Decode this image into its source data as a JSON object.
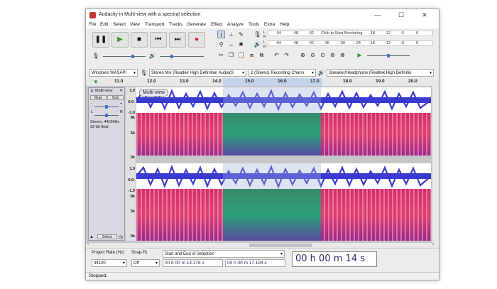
{
  "window": {
    "title": "Audacity in Multi-view with a spectral selection",
    "minimize": "—",
    "maximize": "☐",
    "close": "✕"
  },
  "menu": [
    "File",
    "Edit",
    "Select",
    "View",
    "Transport",
    "Tracks",
    "Generate",
    "Effect",
    "Analyze",
    "Tools",
    "Extra",
    "Help"
  ],
  "transport": {
    "pause": "❚❚",
    "play": "▶",
    "stop": "■",
    "skip_start": "⏮",
    "skip_end": "⏭",
    "record": "●"
  },
  "meters": {
    "record_ticks": [
      "-54",
      "-48",
      "-42",
      "",
      "-18",
      "-12",
      "-6",
      "0"
    ],
    "record_hint": "Click to Start Monitoring",
    "play_ticks": [
      "-54",
      "-48",
      "-42",
      "-36",
      "-30",
      "-24",
      "-18",
      "-12",
      "-6",
      "0"
    ]
  },
  "devices": {
    "host": "Windows WASAPI",
    "recording_device": "Stereo Mix (Realtek High Definition Audio(S",
    "channels": "2 (Stereo) Recording Chann",
    "playback_device": "Speaker/Headphone (Realtek High Definitio"
  },
  "ruler_ticks": [
    "11.0",
    "12.0",
    "13.0",
    "14.0",
    "15.0",
    "16.0",
    "17.0",
    "18.0",
    "19.0",
    "20.0"
  ],
  "track": {
    "name": "Multi-view",
    "mute": "Mute",
    "solo": "Solo",
    "gain_minus": "-",
    "gain_plus": "+",
    "pan_left": "L",
    "pan_right": "R",
    "info_line1": "Stereo, 44100Hz",
    "info_line2": "32-bit float",
    "select": "Select",
    "view_label": "Multi-view",
    "wave_scale": [
      "1.0",
      "0.0-",
      "-1.0"
    ],
    "spec_scale": [
      "8k",
      "5k",
      "0k"
    ],
    "wave_scale2": [
      "1.0",
      "0.0-",
      "-1.0"
    ],
    "spec_scale2": [
      "8k",
      "5k",
      "0k"
    ]
  },
  "bottom": {
    "project_rate_label": "Project Rate (Hz)",
    "project_rate": "44100",
    "snap_label": "Snap-To",
    "snap_value": "Off",
    "selection_mode": "Start and End of Selection",
    "sel_start": "00 h 00 m 14.176 s",
    "sel_end": "00 h 00 m 17.194 s",
    "audio_position": "00 h 00 m 14 s"
  },
  "status": "Stopped."
}
